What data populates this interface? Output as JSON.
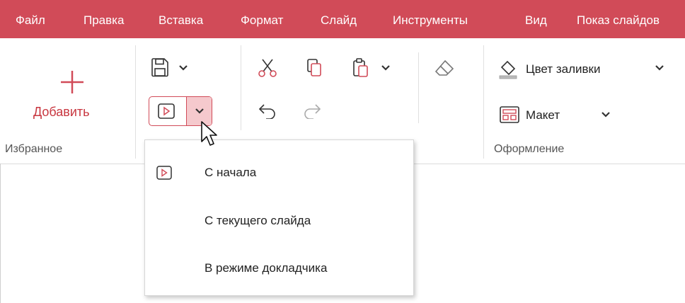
{
  "menubar": {
    "items": [
      {
        "label": "Файл"
      },
      {
        "label": "Правка"
      },
      {
        "label": "Вставка"
      },
      {
        "label": "Формат"
      },
      {
        "label": "Слайд"
      },
      {
        "label": "Инструменты"
      },
      {
        "label": "Вид"
      },
      {
        "label": "Показ слайдов"
      }
    ]
  },
  "ribbon": {
    "favorites": {
      "add_label": "Добавить",
      "group_label": "Избранное"
    },
    "design": {
      "fill_color_label": "Цвет заливки",
      "layout_label": "Макет",
      "group_label": "Оформление"
    }
  },
  "dropdown": {
    "items": [
      {
        "label": "С начала",
        "icon": "play-icon"
      },
      {
        "label": "С текущего слайда"
      },
      {
        "label": "В режиме докладчика"
      }
    ]
  },
  "colors": {
    "accent": "#d14b58",
    "accent_light": "#f5c9cd"
  }
}
